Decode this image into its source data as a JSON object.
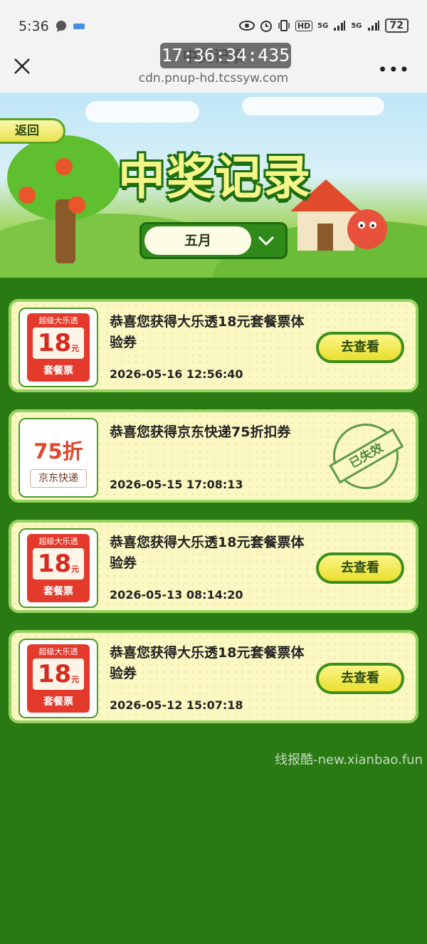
{
  "status_bar": {
    "time": "5:36",
    "network_1": "5G",
    "network_2": "5G",
    "hd": "HD",
    "battery": "72"
  },
  "browser": {
    "page_title": "中奖记录",
    "timestamp_overlay": "17:36:34:435",
    "url": "cdn.pnup-hd.tcssyw.com",
    "more_label": "•••"
  },
  "hero": {
    "back_label": "返回",
    "title": "中奖记录",
    "month_value": "五月"
  },
  "records": [
    {
      "title": "恭喜您获得大乐透18元套餐票体验券",
      "time": "2026-05-16 12:56:40",
      "ticket": {
        "top": "超级大乐透",
        "amount": "18",
        "unit": "元",
        "bottom": "套餐票"
      },
      "action": "去查看"
    },
    {
      "title": "恭喜您获得京东快递75折扣券",
      "time": "2026-05-15 17:08:13",
      "ticket": {
        "big": "75折",
        "sub": "京东快递"
      },
      "status": "已失效"
    },
    {
      "title": "恭喜您获得大乐透18元套餐票体验券",
      "time": "2026-05-13 08:14:20",
      "ticket": {
        "top": "超级大乐透",
        "amount": "18",
        "unit": "元",
        "bottom": "套餐票"
      },
      "action": "去查看"
    },
    {
      "title": "恭喜您获得大乐透18元套餐票体验券",
      "time": "2026-05-12 15:07:18",
      "ticket": {
        "top": "超级大乐透",
        "amount": "18",
        "unit": "元",
        "bottom": "套餐票"
      },
      "action": "去查看"
    }
  ],
  "watermark": "线报酷-new.xianbao.fun",
  "colors": {
    "background_green": "#2a7a14",
    "card_bg": "#fbf8c4",
    "card_border": "#95d35f",
    "ticket_red": "#e43a2c",
    "button_yellow": "#f1e85a"
  }
}
